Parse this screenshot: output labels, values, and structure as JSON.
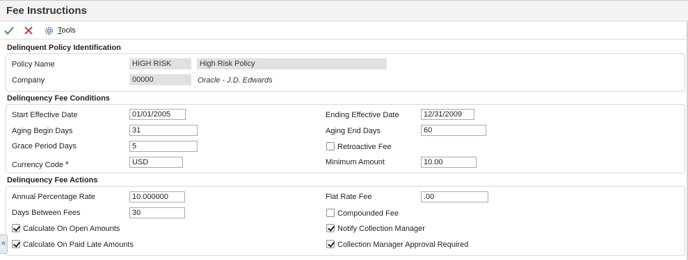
{
  "window": {
    "title": "Fee Instructions"
  },
  "toolbar": {
    "ok_icon": "checkmark-icon",
    "cancel_icon": "close-icon",
    "tools_icon": "gear-icon",
    "tools_label_first": "T",
    "tools_label_rest": "ools"
  },
  "policy_identification": {
    "heading": "Delinquent Policy Identification",
    "policy_name_label": "Policy Name",
    "policy_name_value": "HIGH RISK",
    "policy_description": "High Risk Policy",
    "company_label": "Company",
    "company_value": "00000",
    "company_name": "Oracle - J.D. Edwards"
  },
  "fee_conditions": {
    "heading": "Delinquency Fee Conditions",
    "start_date_label": "Start Effective Date",
    "start_date_value": "01/01/2005",
    "ending_date_label": "Ending Effective Date",
    "ending_date_value": "12/31/2009",
    "aging_begin_label": "Aging Begin Days",
    "aging_begin_value": "31",
    "aging_end_label": "Aging End Days",
    "aging_end_value": "60",
    "grace_label": "Grace Period Days",
    "grace_value": "5",
    "retroactive_label": "Retroactive Fee",
    "retroactive_checked": false,
    "currency_label": "Currency Code",
    "currency_required_marker": "*",
    "currency_value": "USD",
    "min_amount_label": "Minimum Amount",
    "min_amount_value": "10.00"
  },
  "fee_actions": {
    "heading": "Delinquency Fee Actions",
    "apr_label": "Annual Percentage Rate",
    "apr_value": "10.000000",
    "flat_fee_label": "Flat Rate Fee",
    "flat_fee_value": ".00",
    "days_between_label": "Days Between Fees",
    "days_between_value": "30",
    "compounded_label": "Compounded Fee",
    "compounded_checked": false,
    "calc_open_label": "Calculate On Open Amounts",
    "calc_open_checked": true,
    "notify_label": "Notify Collection Manager",
    "notify_checked": true,
    "calc_paid_late_label": "Calculate On Paid Late Amounts",
    "calc_paid_late_checked": true,
    "approval_label": "Collection Manager Approval Required",
    "approval_checked": true
  },
  "side_tab": {
    "glyph": "«"
  },
  "colors": {
    "ok_green": "#3a9a3a",
    "cancel_red": "#d23a3a",
    "required_blue": "#2b6fb6"
  }
}
